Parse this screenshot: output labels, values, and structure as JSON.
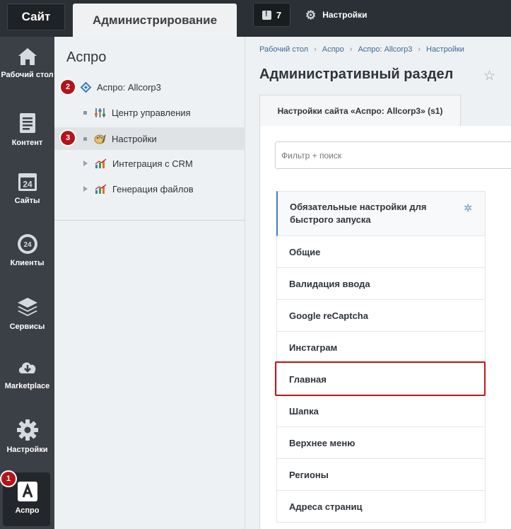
{
  "topbar": {
    "site_tab": "Сайт",
    "admin_tab": "Администрирование",
    "notifications_count": "7",
    "settings_label": "Настройки"
  },
  "rail": {
    "items": [
      {
        "label": "Рабочий стол",
        "icon": "home-icon"
      },
      {
        "label": "Контент",
        "icon": "document-icon"
      },
      {
        "label": "Сайты",
        "icon": "calendar-24-icon"
      },
      {
        "label": "Клиенты",
        "icon": "clients-24-icon"
      },
      {
        "label": "Сервисы",
        "icon": "layers-icon"
      },
      {
        "label": "Marketplace",
        "icon": "cloud-download-icon"
      },
      {
        "label": "Настройки",
        "icon": "gear-icon"
      },
      {
        "label": "Аспро",
        "icon": "aspro-logo-icon"
      }
    ],
    "active_index": 7
  },
  "badges": {
    "one": "1",
    "two": "2",
    "three": "3"
  },
  "menu": {
    "title": "Аспро",
    "items": [
      {
        "label": "Аспро: Allcorp3",
        "marker": "none"
      },
      {
        "label": "Центр управления",
        "marker": "bullet"
      },
      {
        "label": "Настройки",
        "marker": "bullet"
      },
      {
        "label": "Интеграция с CRM",
        "marker": "arrow"
      },
      {
        "label": "Генерация файлов",
        "marker": "arrow"
      }
    ],
    "selected_index": 2
  },
  "breadcrumbs": [
    "Рабочий стол",
    "Аспро",
    "Аспро: Allcorp3",
    "Настройки"
  ],
  "page_title": "Административный раздел",
  "site_tab_label": "Настройки сайта «Аспро: Allcorp3» (s1)",
  "filter_placeholder": "Фильтр + поиск",
  "sections": [
    "Обязательные настройки для быстрого запуска",
    "Общие",
    "Валидация ввода",
    "Google reCaptcha",
    "Инстаграм",
    "Главная",
    "Шапка",
    "Верхнее меню",
    "Регионы",
    "Адреса страниц"
  ],
  "highlighted_section": "Главная",
  "colors": {
    "accent": "#3b7dbf",
    "badge": "#b3131a",
    "rail": "#3b4047",
    "topbar": "#2b3036"
  }
}
